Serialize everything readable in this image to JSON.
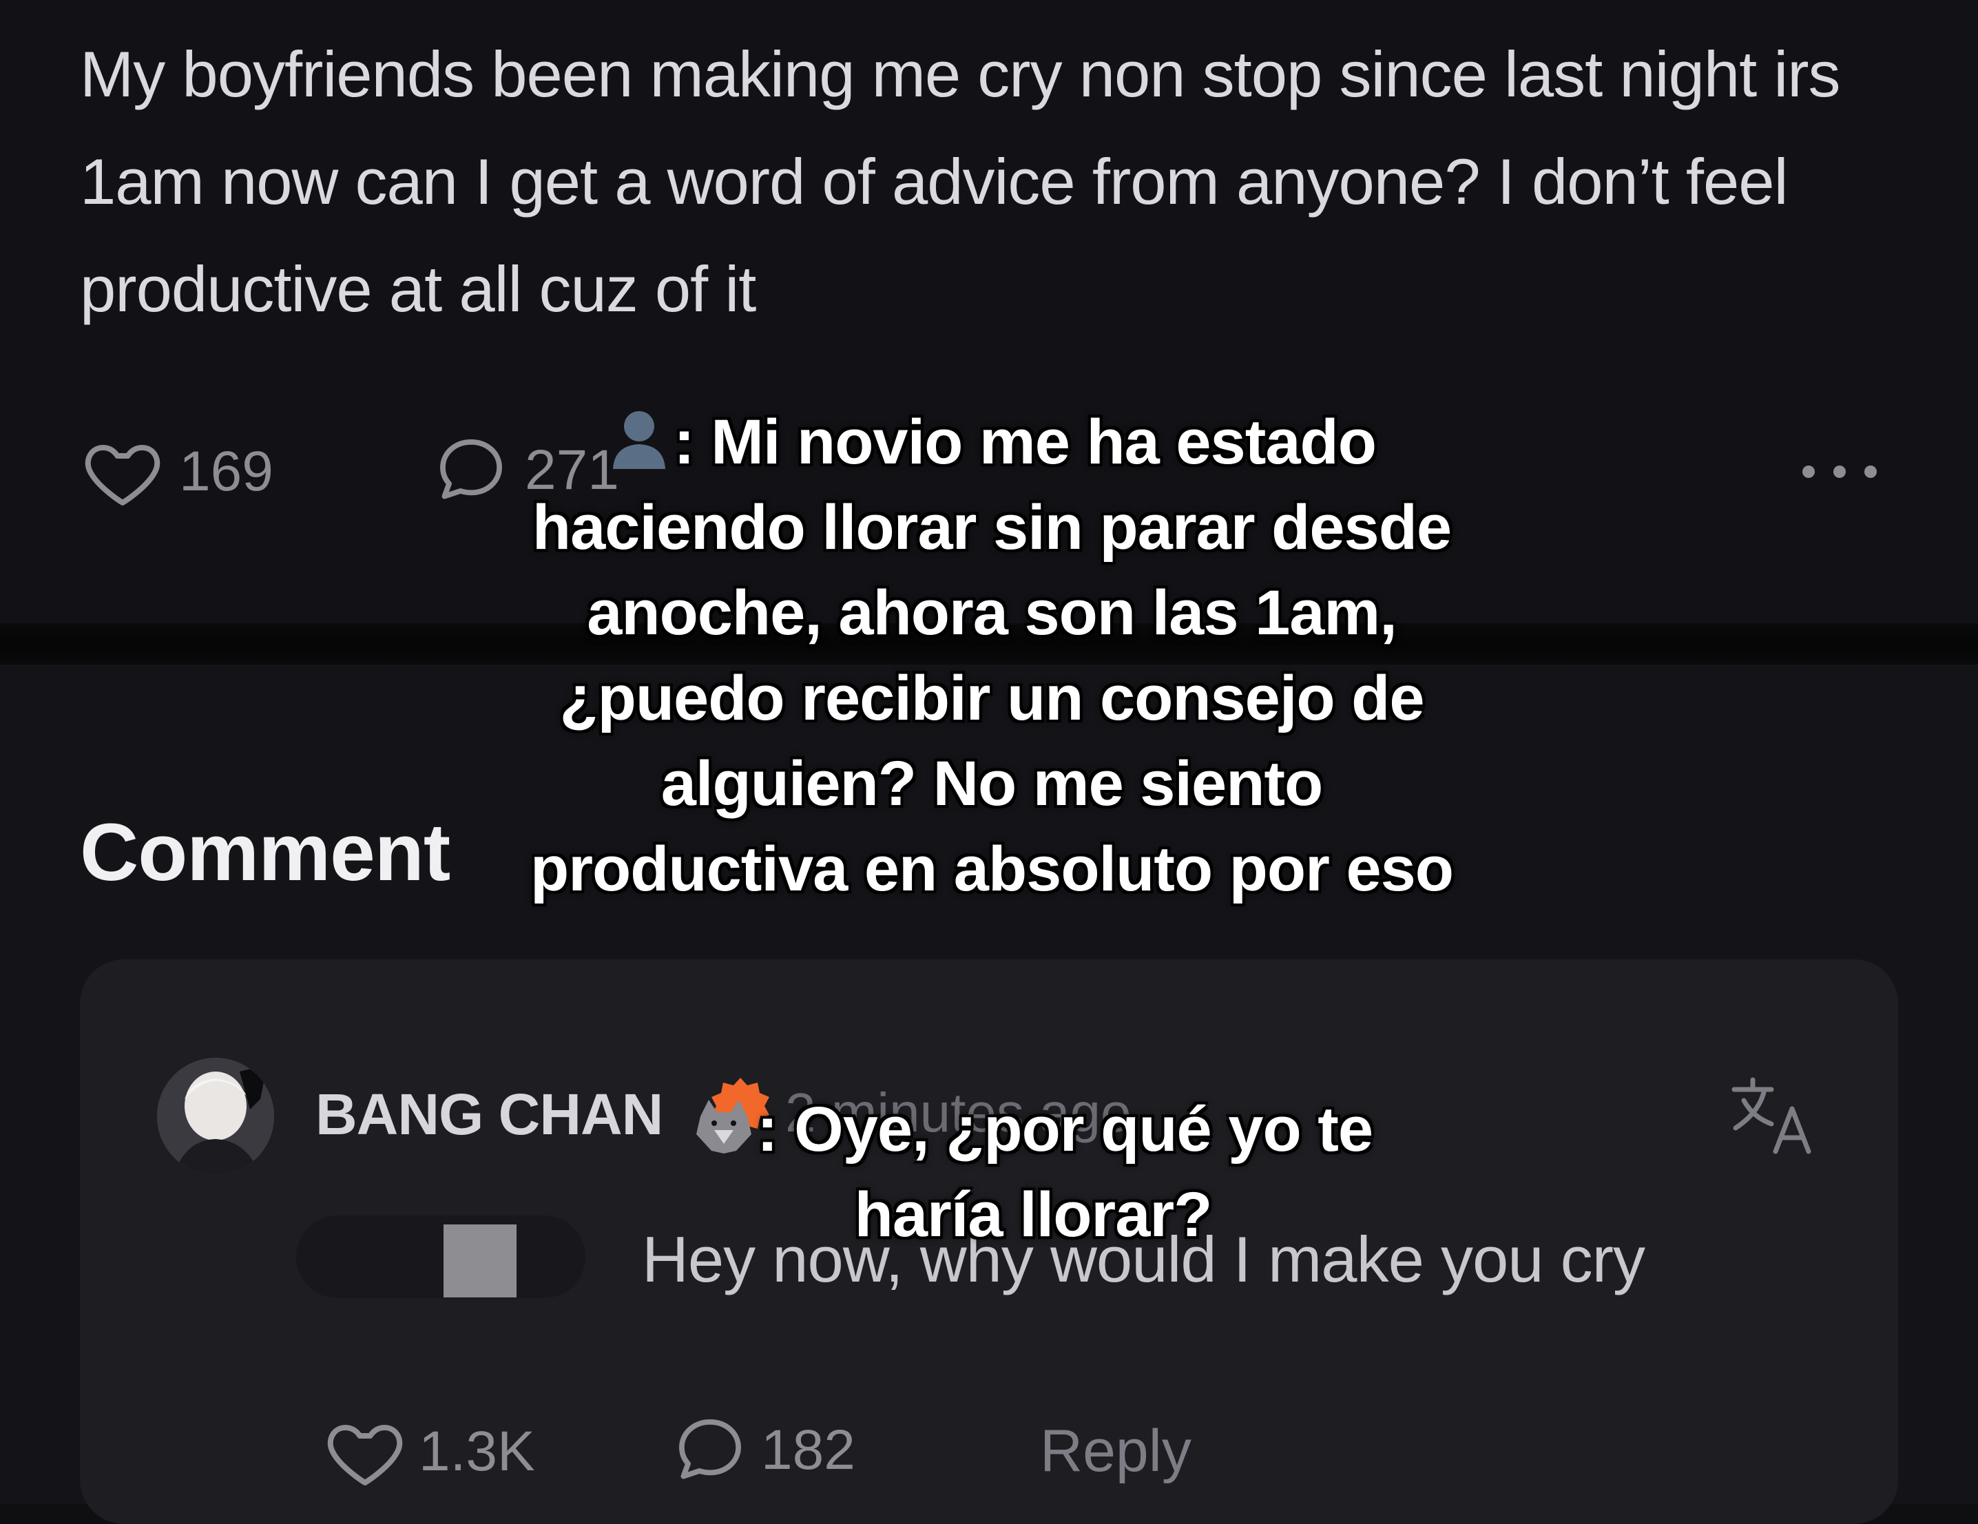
{
  "post": {
    "text": "My boyfriends been making me cry non stop since last night irs 1am now can I get a word of advice from anyone? I don’t feel productive at all cuz of it",
    "likes": "169",
    "comments": "271",
    "more": "..."
  },
  "comments_section": {
    "heading": "Comment",
    "comment": {
      "username": "BANG CHAN",
      "timestamp": "2 minutes ago",
      "text": "Hey now, why would I make you cry",
      "likes": "1.3K",
      "replies": "182",
      "reply_label": "Reply"
    }
  },
  "captions": {
    "caption_1": ": Mi novio me ha estado haciendo llorar sin parar desde anoche, ahora son las 1am, ¿puedo recibir un consejo de alguien? No me siento productiva en absoluto por eso",
    "caption_2": ": Oye, ¿por qué yo te haría llorar?"
  },
  "icons": {
    "like": "heart-icon",
    "comment": "comment-bubble-icon",
    "more": "more-dots-icon",
    "translate": "translate-icon",
    "verified": "verified-badge-icon",
    "caption_1_emoji": "person-silhouette-icon",
    "caption_2_emoji": "wolf-icon"
  },
  "colors": {
    "background": "#121216",
    "text_primary": "#d9d9de",
    "text_muted": "#8d8d94",
    "card": "#1d1d22",
    "badge": "#f2672a"
  }
}
